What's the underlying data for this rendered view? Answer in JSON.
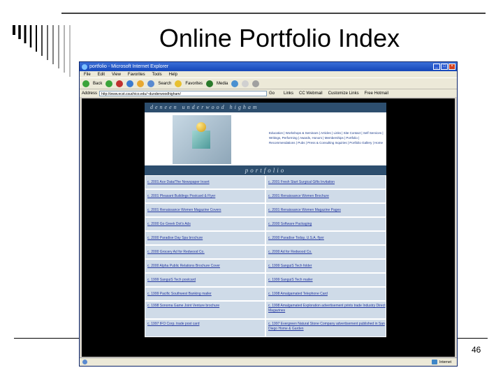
{
  "slide": {
    "title": "Online Portfolio Index",
    "page_number": "46"
  },
  "browser": {
    "title": "portfolio - Microsoft Internet Explorer",
    "menu": [
      "File",
      "Edit",
      "View",
      "Favorites",
      "Tools",
      "Help"
    ],
    "toolbar": {
      "back": "Back",
      "search": "Search",
      "favorites": "Favorites",
      "media": "Media",
      "go": "Go"
    },
    "address_label": "Address",
    "address_value": "http://www.ecst.csuchico.edu/~dunderwoodhigham/",
    "links": [
      "Links",
      "CC Webmail",
      "Customize Links",
      "Free Hotmail"
    ],
    "status_zone": "Internet"
  },
  "site": {
    "header": "deneen underwood higham",
    "intro": "Education | Workshops & Seminars | Articles | Links | Site Contact | Self Services | Writings, Performing | Awards, Honors | Memberships | Portfolio | Recommendations | Pubs | Press & Consulting Inquiries | Portfolio Gallery | Home",
    "portfolio_title": "portfolio",
    "items_left": [
      "c. 2001 Ace Data/The Newspaper Insert",
      "c. 2001 Pleasant Buildings Postcard & Flyer",
      "c. 2001 Renaissance Women Magazine Covers",
      "c. 2000 Go Greek Dot's Ads",
      "c. 2000 Paradise Day Spa brochure",
      "c. 2000 Grocery Ad for Redwood Co.",
      "c. 2000 Alpha Public Relations Brochure Cover",
      "c. 1999 SanguiS Tech postcard",
      "c. 1999 Pacific Southwest Banking mailer",
      "c. 1998 Sonoma Game Joint Venture brochure",
      "c. 1997 IFO Corp. trade post card"
    ],
    "items_right": [
      "c. 2001 Fresh Start Surgical Gifts Invitation",
      "c. 2001 Renaissance Women Brochure",
      "c. 2001 Renaissance Women Magazine Pages",
      "c. 2000 Software Packaging",
      "c. 2000 Paradise Today, U.S.A. flyer",
      "c. 2000 Ad for Redwood Co.",
      "c. 1999 SanguiS Tech folder",
      "c. 1999 SanguiS Tech mailer",
      "c. 1998 Amalgamated Telephone Card",
      "c. 1998 Amalgamated Exploration advertisement prints trade Industry Direct Magazines",
      "c. 1997 Evergreen Natural Stone Company advertisement published in San Diego Home & Garden"
    ]
  }
}
